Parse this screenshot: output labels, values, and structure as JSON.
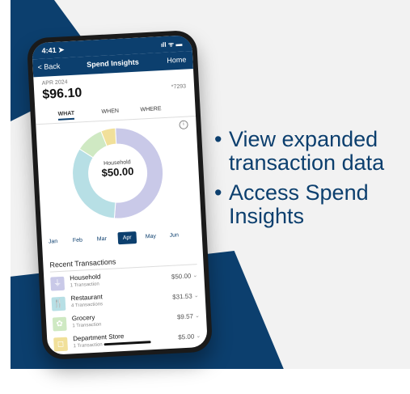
{
  "colors": {
    "brand": "#0c3f6e",
    "household": "#c9c9e8",
    "restaurant": "#b7dfe5",
    "grocery": "#cfe9c3",
    "department": "#f1e09a"
  },
  "status": {
    "time": "4:41 ➤",
    "signal": "ıll ᯤ ▬"
  },
  "nav": {
    "back": "< Back",
    "title": "Spend Insights",
    "home": "Home"
  },
  "summary": {
    "period": "APR 2024",
    "amount": "$96.10",
    "account": "*7293"
  },
  "tabs": [
    "WHAT",
    "WHEN",
    "WHERE"
  ],
  "donut": {
    "category": "Household",
    "value": "$50.00"
  },
  "chart_data": {
    "type": "pie",
    "categories": [
      "Household",
      "Restaurant",
      "Grocery",
      "Department Store"
    ],
    "values": [
      50.0,
      31.53,
      9.57,
      5.0
    ]
  },
  "months": [
    "Jan",
    "Feb",
    "Mar",
    "Apr",
    "May",
    "Jun"
  ],
  "active_month": "Apr",
  "recent_title": "Recent Transactions",
  "transactions": [
    {
      "name": "Household",
      "count": "1 Transaction",
      "amount": "$50.00",
      "icon": "plug-icon"
    },
    {
      "name": "Restaurant",
      "count": "4 Transactions",
      "amount": "$31.53",
      "icon": "utensils-icon"
    },
    {
      "name": "Grocery",
      "count": "1 Transaction",
      "amount": "$9.57",
      "icon": "grocery-icon"
    },
    {
      "name": "Department Store",
      "count": "1 Transaction",
      "amount": "$5.00",
      "icon": "shopping-bag-icon"
    }
  ],
  "bullets": [
    "View expanded transaction data",
    "Access Spend Insights"
  ]
}
